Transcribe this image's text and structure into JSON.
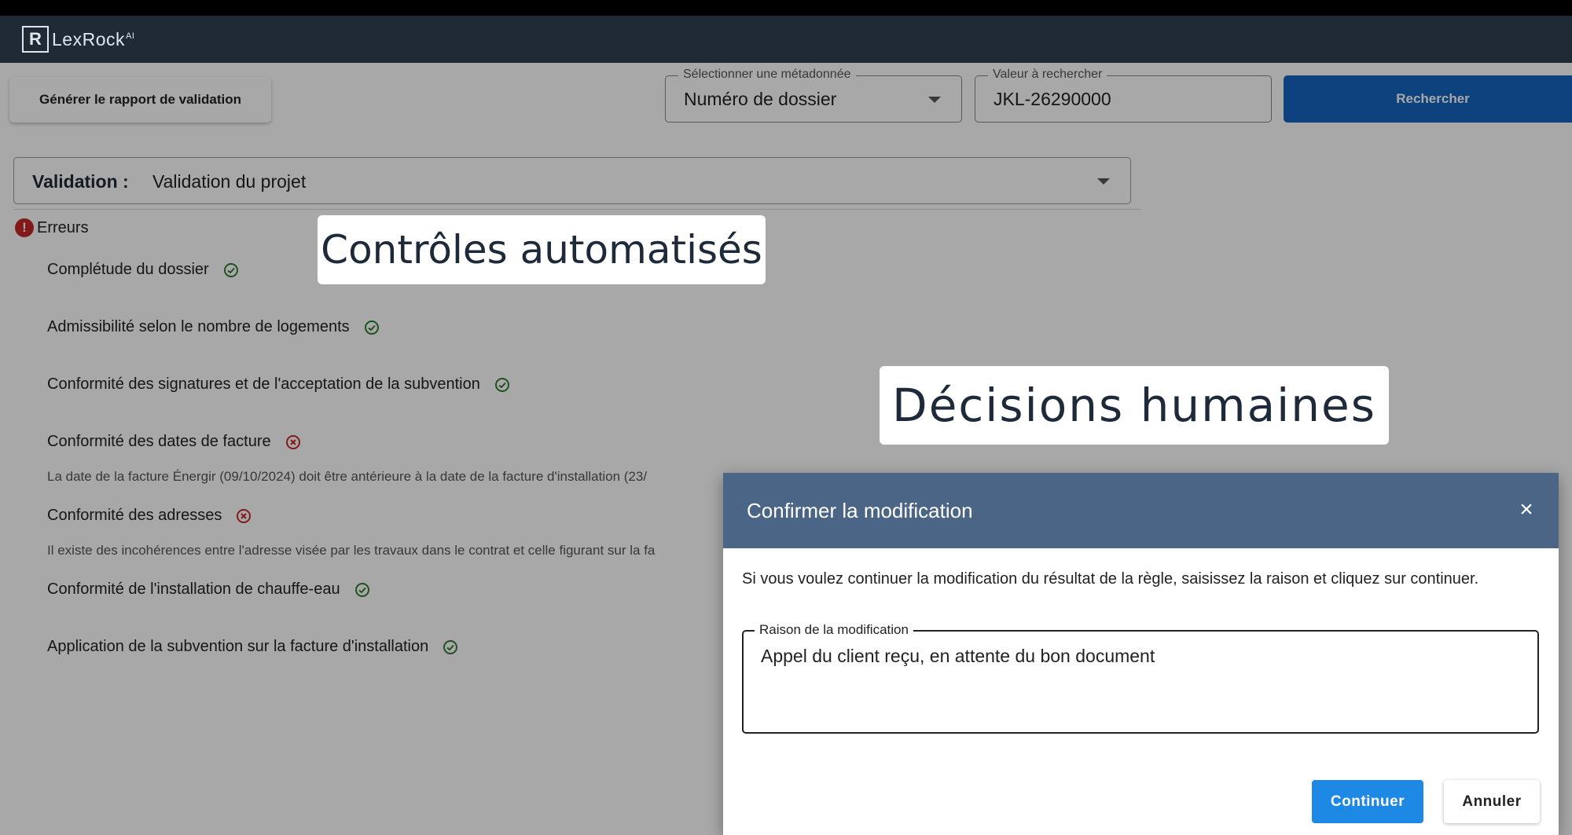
{
  "app": {
    "logo_mark": "R",
    "logo_text": "LexRock",
    "logo_sup": "AI"
  },
  "toolbar": {
    "report_button": "Générer le rapport de validation",
    "metadata_label": "Sélectionner une métadonnée",
    "metadata_value": "Numéro de dossier",
    "search_value_label": "Valeur à rechercher",
    "search_value": "JKL-26290000",
    "search_button": "Rechercher"
  },
  "validation": {
    "key": "Validation :",
    "value": "Validation du projet"
  },
  "errors": {
    "icon": "!",
    "label": "Erreurs"
  },
  "rules": [
    {
      "label": "Complétude du dossier",
      "status": "pass"
    },
    {
      "label": "Admissibilité selon le nombre de logements",
      "status": "pass"
    },
    {
      "label": "Conformité des signatures et de l'acceptation de la subvention",
      "status": "pass"
    },
    {
      "label": "Conformité des dates de facture",
      "status": "fail",
      "detail": "La date de la facture Énergir (09/10/2024) doit être antérieure à la date de la facture d'installation (23/"
    },
    {
      "label": "Conformité des adresses",
      "status": "fail",
      "detail": "Il existe des incohérences entre l'adresse visée par les travaux dans le contrat et celle figurant sur la fa"
    },
    {
      "label": "Conformité de l'installation de chauffe-eau",
      "status": "pass"
    },
    {
      "label": "Application de la subvention sur la facture d'installation",
      "status": "pass"
    }
  ],
  "captions": {
    "automated": "Contrôles automatisés",
    "human": "Décisions humaines"
  },
  "modal": {
    "title": "Confirmer la modification",
    "close": "×",
    "message": "Si vous voulez continuer la modification du résultat de la règle, saisissez la raison et cliquez sur continuer.",
    "reason_label": "Raison de la modification",
    "reason_value": "Appel du client reçu, en attente du bon document",
    "continue_button": "Continuer",
    "cancel_button": "Annuler"
  },
  "colors": {
    "appbar": "#1f2a35",
    "primary": "#1565c0",
    "modal_header": "#4b6586",
    "pass": "#2e7d32",
    "fail": "#c62828"
  }
}
